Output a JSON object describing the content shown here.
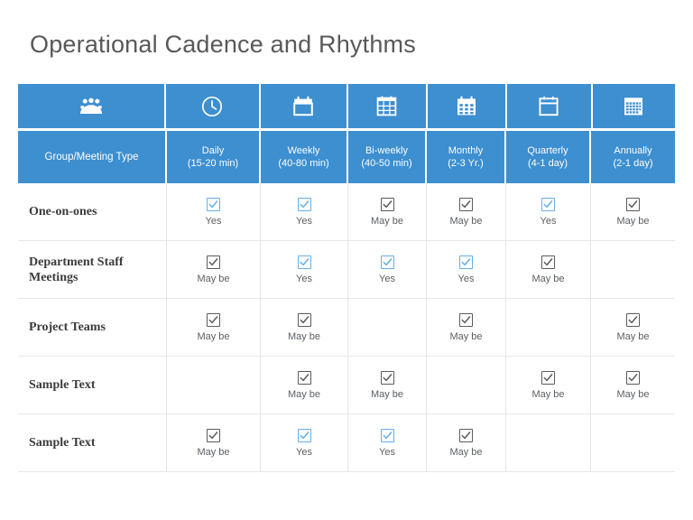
{
  "slide": {
    "title": "Operational Cadence and Rhythms",
    "accent_color": "#3d8fd0",
    "yes_color": "#63b0e6",
    "maybe_color": "#5b5b5b",
    "title_color": "#58595b"
  },
  "table": {
    "icons": [
      "people-group-icon",
      "clock-icon",
      "calendar-blank-icon",
      "calendar-grid-icon",
      "calendar-month-icon",
      "calendar-outline-icon",
      "calendar-dense-grid-icon"
    ],
    "columns": [
      {
        "main": "Group/Meeting Type",
        "sub": ""
      },
      {
        "main": "Daily",
        "sub": "(15-20 min)"
      },
      {
        "main": "Weekly",
        "sub": "(40-80 min)"
      },
      {
        "main": "Bi-weekly",
        "sub": "(40-50 min)"
      },
      {
        "main": "Monthly",
        "sub": "(2-3 Yr.)"
      },
      {
        "main": "Quarterly",
        "sub": "(4-1 day)"
      },
      {
        "main": "Annually",
        "sub": "(2-1 day)"
      }
    ],
    "rows": [
      {
        "label": "One-on-ones",
        "cells": [
          {
            "state": "yes",
            "text": "Yes"
          },
          {
            "state": "yes",
            "text": "Yes"
          },
          {
            "state": "maybe",
            "text": "May be"
          },
          {
            "state": "maybe",
            "text": "May be"
          },
          {
            "state": "yes",
            "text": "Yes"
          },
          {
            "state": "maybe",
            "text": "May be"
          }
        ]
      },
      {
        "label": "Department Staff Meetings",
        "cells": [
          {
            "state": "maybe",
            "text": "May be"
          },
          {
            "state": "yes",
            "text": "Yes"
          },
          {
            "state": "yes",
            "text": "Yes"
          },
          {
            "state": "yes",
            "text": "Yes"
          },
          {
            "state": "maybe",
            "text": "May be"
          },
          {
            "state": "empty",
            "text": ""
          }
        ]
      },
      {
        "label": "Project Teams",
        "cells": [
          {
            "state": "maybe",
            "text": "May be"
          },
          {
            "state": "maybe",
            "text": "May be"
          },
          {
            "state": "empty",
            "text": ""
          },
          {
            "state": "maybe",
            "text": "May be"
          },
          {
            "state": "empty",
            "text": ""
          },
          {
            "state": "maybe",
            "text": "May be"
          }
        ]
      },
      {
        "label": "Sample Text",
        "cells": [
          {
            "state": "empty",
            "text": ""
          },
          {
            "state": "maybe",
            "text": "May be"
          },
          {
            "state": "maybe",
            "text": "May be"
          },
          {
            "state": "empty",
            "text": ""
          },
          {
            "state": "maybe",
            "text": "May be"
          },
          {
            "state": "maybe",
            "text": "May be"
          }
        ]
      },
      {
        "label": "Sample Text",
        "cells": [
          {
            "state": "maybe",
            "text": "May be"
          },
          {
            "state": "yes",
            "text": "Yes"
          },
          {
            "state": "yes",
            "text": "Yes"
          },
          {
            "state": "maybe",
            "text": "May be"
          },
          {
            "state": "empty",
            "text": ""
          },
          {
            "state": "empty",
            "text": ""
          }
        ]
      }
    ]
  }
}
